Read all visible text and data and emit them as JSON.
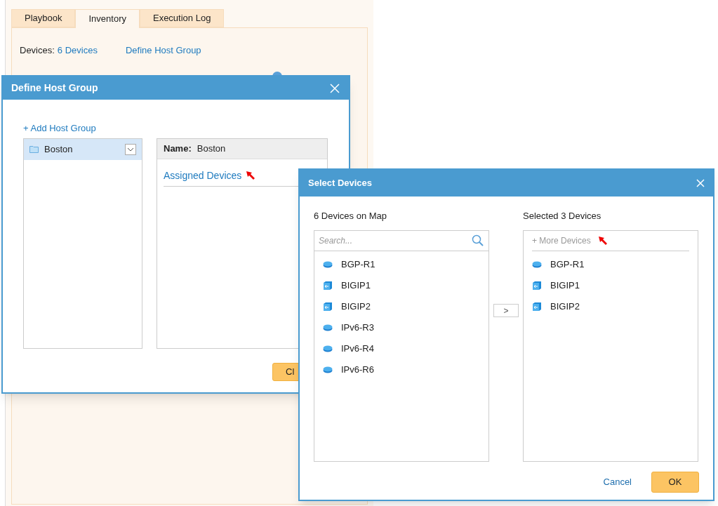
{
  "tabs": [
    {
      "label": "Playbook",
      "selected": false
    },
    {
      "label": "Inventory",
      "selected": true
    },
    {
      "label": "Execution Log",
      "selected": false
    }
  ],
  "devices_label": "Devices:",
  "devices_link": "6 Devices",
  "define_host_group_link": "Define Host Group",
  "host_group_dialog": {
    "title": "Define Host Group",
    "add_link": "+ Add Host Group",
    "groups": [
      {
        "name": "Boston",
        "selected": true
      }
    ],
    "name_label": "Name:",
    "name_value": "Boston",
    "assigned_devices": "Assigned Devices",
    "button": "Cl"
  },
  "select_dialog": {
    "title": "Select Devices",
    "left_heading": "6 Devices on Map",
    "search": {
      "placeholder": "Search..."
    },
    "available": [
      {
        "name": "BGP-R1",
        "kind": "router"
      },
      {
        "name": "BIGIP1",
        "kind": "balancer"
      },
      {
        "name": "BIGIP2",
        "kind": "balancer"
      },
      {
        "name": "IPv6-R3",
        "kind": "router"
      },
      {
        "name": "IPv6-R4",
        "kind": "router"
      },
      {
        "name": "IPv6-R6",
        "kind": "router"
      }
    ],
    "move_button": ">",
    "right_heading": "Selected 3 Devices",
    "more_devices": "+ More Devices",
    "selected": [
      {
        "name": "BGP-R1",
        "kind": "router"
      },
      {
        "name": "BIGIP1",
        "kind": "balancer"
      },
      {
        "name": "BIGIP2",
        "kind": "balancer"
      }
    ],
    "cancel": "Cancel",
    "ok": "OK"
  }
}
